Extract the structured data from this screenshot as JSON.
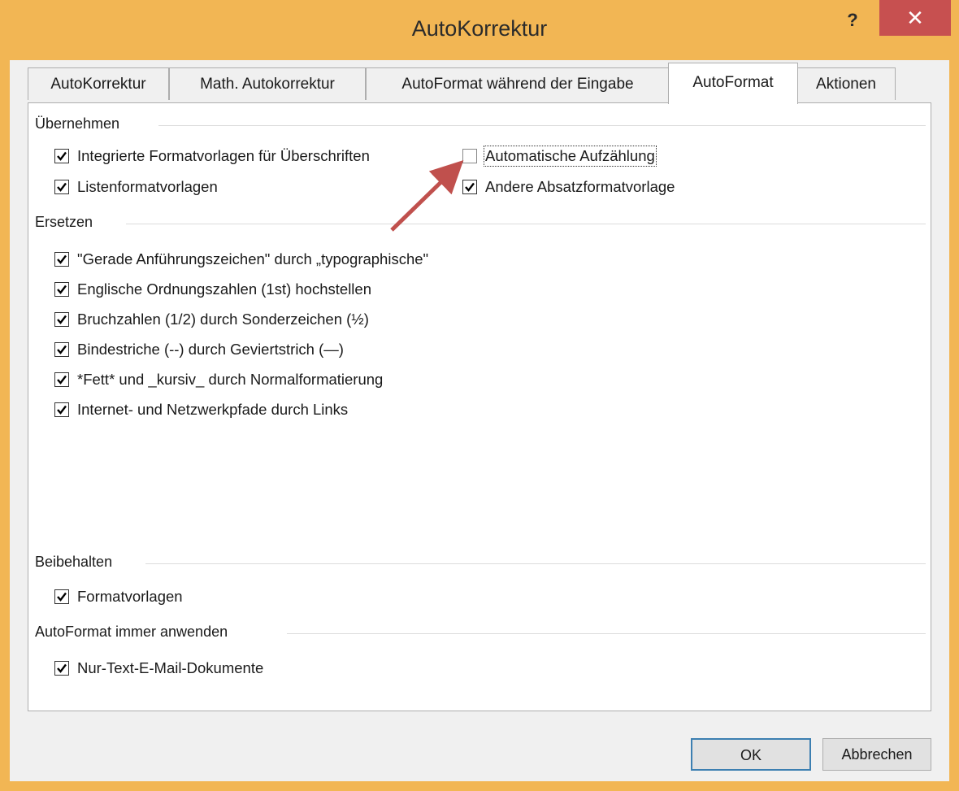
{
  "window": {
    "title": "AutoKorrektur",
    "help_label": "?",
    "close_label": "✕"
  },
  "tabs": [
    {
      "label": "AutoKorrektur"
    },
    {
      "label": "Math. Autokorrektur"
    },
    {
      "label": "AutoFormat während der Eingabe"
    },
    {
      "label": "AutoFormat"
    },
    {
      "label": "Aktionen"
    }
  ],
  "groups": {
    "apply": "Übernehmen",
    "replace": "Ersetzen",
    "keep": "Beibehalten",
    "always": "AutoFormat immer anwenden"
  },
  "apply_items": [
    {
      "label": "Integrierte Formatvorlagen für Überschriften",
      "checked": true
    },
    {
      "label": "Listenformatvorlagen",
      "checked": true
    },
    {
      "label": "Automatische Aufzählung",
      "checked": false
    },
    {
      "label": "Andere Absatzformatvorlage",
      "checked": true
    }
  ],
  "replace_items": [
    {
      "label": "\"Gerade Anführungszeichen\" durch „typographische\"",
      "checked": true
    },
    {
      "label": "Englische Ordnungszahlen (1st) hochstellen",
      "checked": true
    },
    {
      "label": "Bruchzahlen (1/2) durch Sonderzeichen (½)",
      "checked": true
    },
    {
      "label": "Bindestriche (--) durch Geviertstrich (—)",
      "checked": true
    },
    {
      "label": "*Fett* und _kursiv_ durch Normalformatierung",
      "checked": true
    },
    {
      "label": "Internet- und Netzwerkpfade durch Links",
      "checked": true
    }
  ],
  "keep_items": [
    {
      "label": "Formatvorlagen",
      "checked": true
    }
  ],
  "always_items": [
    {
      "label": "Nur-Text-E-Mail-Dokumente",
      "checked": true
    }
  ],
  "buttons": {
    "ok": "OK",
    "cancel": "Abbrechen"
  },
  "colors": {
    "frame": "#f2b654",
    "close": "#c75050",
    "arrow": "#c0504d"
  }
}
